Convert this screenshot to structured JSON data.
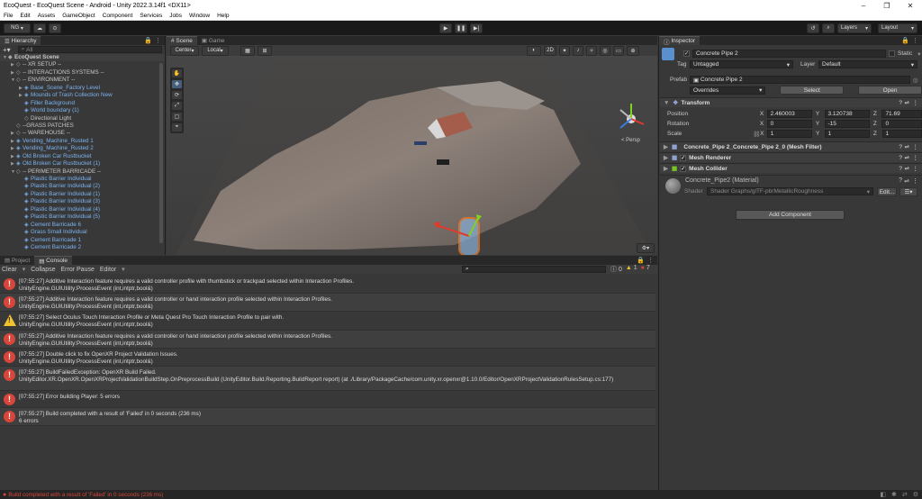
{
  "window": {
    "title": "EcoQuest - EcoQuest Scene - Android - Unity 2022.3.14f1 <DX11>",
    "controls": [
      "–",
      "❐",
      "✕"
    ]
  },
  "menu": [
    "File",
    "Edit",
    "Assets",
    "GameObject",
    "Component",
    "Services",
    "Jobs",
    "Window",
    "Help"
  ],
  "toolbar": {
    "account": "NG",
    "layers": "Layers",
    "layout": "Layout"
  },
  "hierarchy": {
    "tab": "Hierarchy",
    "search_placeholder": "All",
    "scene": "EcoQuest Scene",
    "items": [
      {
        "label": "-- XR SETUP --",
        "blue": false
      },
      {
        "label": "-- INTERACTIONS SYSTEMS --",
        "blue": false
      },
      {
        "label": "-- ENVIRONMENT --",
        "blue": false
      },
      {
        "label": "Base_Scene_Factory Level",
        "blue": true
      },
      {
        "label": "Mounds of Trash Collection New",
        "blue": true
      },
      {
        "label": "Filler Background",
        "blue": true
      },
      {
        "label": "World boundary (1)",
        "blue": true
      },
      {
        "label": "Directional Light",
        "blue": false
      },
      {
        "label": "--GRASS PATCHES",
        "blue": false
      },
      {
        "label": "-- WAREHOUSE --",
        "blue": false
      },
      {
        "label": "Vending_Machine_Rusted 1",
        "blue": true
      },
      {
        "label": "Vending_Machine_Rusted 2",
        "blue": true
      },
      {
        "label": "Old Broken Car Rustbucket",
        "blue": true
      },
      {
        "label": "Old Broken Car Rustbucket (1)",
        "blue": true
      },
      {
        "label": "-- PERIMETER BARRICADE --",
        "blue": false
      },
      {
        "label": "Plastic Barrier Individual",
        "blue": true
      },
      {
        "label": "Plastic Barrier Individual (2)",
        "blue": true
      },
      {
        "label": "Plastic Barrier Individual (1)",
        "blue": true
      },
      {
        "label": "Plastic Barrier Individual (3)",
        "blue": true
      },
      {
        "label": "Plastic Barrier Individual (4)",
        "blue": true
      },
      {
        "label": "Plastic Barrier Individual (5)",
        "blue": true
      },
      {
        "label": "Cement Barricade 6",
        "blue": true
      },
      {
        "label": "Grass Small Individual",
        "blue": true
      },
      {
        "label": "Cement Barricade 1",
        "blue": true
      },
      {
        "label": "Cement Barricade 2",
        "blue": true
      }
    ]
  },
  "scene": {
    "tabs": [
      "Scene",
      "Game"
    ],
    "pivot": "Center",
    "space": "Local",
    "mode2d": "2D",
    "persp": "< Persp"
  },
  "console": {
    "tabs": [
      "Project",
      "Console"
    ],
    "buttons": [
      "Clear",
      "Collapse",
      "Error Pause",
      "Editor"
    ],
    "counts": {
      "info": "0",
      "warn": "1",
      "error": "7"
    },
    "entries": [
      {
        "type": "error",
        "l1": "[07:55:27] Additive Interaction feature requires a valid controller profile with thumbstick or trackpad selected within Interaction Profiles.",
        "l2": "UnityEngine.GUIUtility:ProcessEvent (int,intptr,bool&)"
      },
      {
        "type": "error",
        "l1": "[07:55:27] Additive Interaction feature requires a valid controller or hand interaction profile selected within Interaction Profiles.",
        "l2": "UnityEngine.GUIUtility:ProcessEvent (int,intptr,bool&)"
      },
      {
        "type": "warn",
        "l1": "[07:55:27] Select Oculus Touch Interaction Profile or Meta Quest Pro Touch Interaction Profile to pair with.",
        "l2": "UnityEngine.GUIUtility:ProcessEvent (int,intptr,bool&)"
      },
      {
        "type": "error",
        "l1": "[07:55:27] Additive Interaction feature requires a valid controller or hand interaction profile selected within Interaction Profiles.",
        "l2": "UnityEngine.GUIUtility:ProcessEvent (int,intptr,bool&)"
      },
      {
        "type": "error",
        "l1": "[07:55:27] Double click to fix OpenXR Project Validation Issues.",
        "l2": "UnityEngine.GUIUtility:ProcessEvent (int,intptr,bool&)"
      },
      {
        "type": "error",
        "l1": "[07:55:27] BuildFailedException: OpenXR Build Failed.",
        "l2": "UnityEditor.XR.OpenXR.OpenXRProjectValidationBuildStep.OnPreprocessBuild (UnityEditor.Build.Reporting.BuildReport report) (at ./Library/PackageCache/com.unity.xr.openxr@1.10.0/Editor/OpenXRProjectValidationRulesSetup.cs:177)"
      },
      {
        "type": "error",
        "l1": "[07:55:27] Error building Player: 5 errors",
        "l2": ""
      },
      {
        "type": "error",
        "l1": "[07:55:27] Build completed with a result of 'Failed' in 0 seconds (236 ms)",
        "l2": "6 errors"
      }
    ]
  },
  "status": "Build completed with a result of 'Failed' in 0 seconds (236 ms)",
  "inspector": {
    "tab": "Inspector",
    "name": "Concrete Pipe 2",
    "static": "Static",
    "tag_label": "Tag",
    "tag": "Untagged",
    "layer_label": "Layer",
    "layer": "Default",
    "prefab_label": "Prefab",
    "prefab": "Concrete Pipe 2",
    "overrides": "Overrides",
    "select": "Select",
    "open": "Open",
    "transform": "Transform",
    "position": {
      "label": "Position",
      "x": "2.460003",
      "y": "3.120738",
      "z": "71.69"
    },
    "rotation": {
      "label": "Rotation",
      "x": "0",
      "y": "-15",
      "z": "0"
    },
    "scale": {
      "label": "Scale",
      "x": "1",
      "y": "1",
      "z": "1"
    },
    "mesh_filter": "Concrete_Pipe 2_Concrete_Pipe 2_0 (Mesh Filter)",
    "mesh_renderer": "Mesh Renderer",
    "mesh_collider": "Mesh Collider",
    "material": "Concrete_Pipe2 (Material)",
    "shader_label": "Shader",
    "shader": "Shader Graphs/glTF-pbrMetallicRoughness",
    "edit": "Edit...",
    "add_component": "Add Component"
  }
}
